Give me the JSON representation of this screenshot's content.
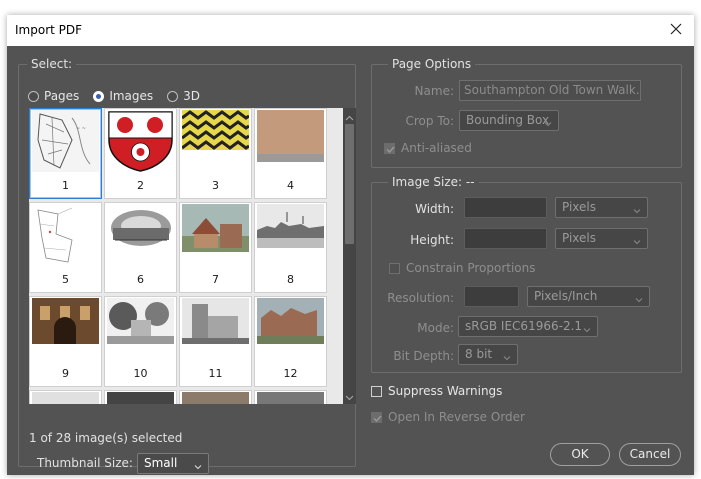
{
  "window": {
    "title": "Import PDF"
  },
  "select": {
    "legend": "Select:",
    "modes": [
      {
        "label": "Pages",
        "checked": false
      },
      {
        "label": "Images",
        "checked": true
      },
      {
        "label": "3D",
        "checked": false
      }
    ],
    "thumbnails": [
      {
        "label": "1",
        "selected": true,
        "icon": "map-sketch"
      },
      {
        "label": "2",
        "selected": false,
        "icon": "shield-crest"
      },
      {
        "label": "3",
        "selected": false,
        "icon": "chevron-pattern"
      },
      {
        "label": "4",
        "selected": false,
        "icon": "tan-swatch"
      },
      {
        "label": "5",
        "selected": false,
        "icon": "line-map"
      },
      {
        "label": "6",
        "selected": false,
        "icon": "engraving-arch"
      },
      {
        "label": "7",
        "selected": false,
        "icon": "house-illustration"
      },
      {
        "label": "8",
        "selected": false,
        "icon": "harbour-panorama"
      },
      {
        "label": "9",
        "selected": false,
        "icon": "gatehouse-photo"
      },
      {
        "label": "10",
        "selected": false,
        "icon": "tree-engraving"
      },
      {
        "label": "11",
        "selected": false,
        "icon": "tower-engraving"
      },
      {
        "label": "12",
        "selected": false,
        "icon": "ruins-illustration"
      }
    ],
    "status": "1 of 28 image(s) selected",
    "thumbnail_size_label": "Thumbnail Size:",
    "thumbnail_size_value": "Small"
  },
  "page_options": {
    "legend": "Page Options",
    "name_label": "Name:",
    "name_value": "Southampton Old Town Walk.p",
    "crop_label": "Crop To:",
    "crop_value": "Bounding Box",
    "antialiased_label": "Anti-aliased",
    "antialiased_checked": true
  },
  "image_size": {
    "legend": "Image Size: --",
    "width_label": "Width:",
    "width_unit": "Pixels",
    "height_label": "Height:",
    "height_unit": "Pixels",
    "constrain_label": "Constrain Proportions",
    "resolution_label": "Resolution:",
    "resolution_unit": "Pixels/Inch",
    "mode_label": "Mode:",
    "mode_value": "sRGB IEC61966-2.1",
    "bitdepth_label": "Bit Depth:",
    "bitdepth_value": "8 bit"
  },
  "options": {
    "suppress_label": "Suppress Warnings",
    "suppress_checked": false,
    "reverse_label": "Open In Reverse Order",
    "reverse_checked": true
  },
  "buttons": {
    "ok": "OK",
    "cancel": "Cancel"
  }
}
